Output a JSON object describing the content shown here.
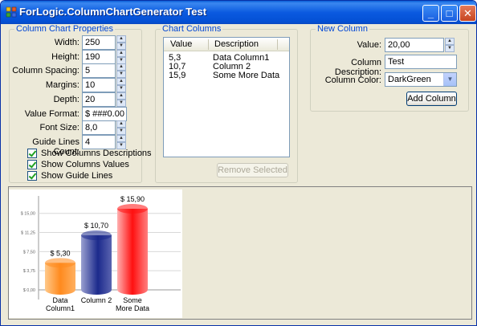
{
  "window": {
    "title": "ForLogic.ColumnChartGenerator Test"
  },
  "titlebar_buttons": {
    "minimize": "_",
    "maximize": "□",
    "close": "✕"
  },
  "props": {
    "group_label": "Column Chart Properties",
    "fields": [
      {
        "label": "Width:",
        "value": "250"
      },
      {
        "label": "Height:",
        "value": "190"
      },
      {
        "label": "Column Spacing:",
        "value": "5"
      },
      {
        "label": "Margins:",
        "value": "10"
      },
      {
        "label": "Depth:",
        "value": "20"
      },
      {
        "label": "Value Format:",
        "value": "$ ###0.00"
      },
      {
        "label": "Font Size:",
        "value": "8,0"
      },
      {
        "label": "Guide Lines Count:",
        "value": "4"
      }
    ],
    "checks": [
      {
        "label": "Show Columns Descriptions",
        "checked": true
      },
      {
        "label": "Show Columns Values",
        "checked": true
      },
      {
        "label": "Show Guide Lines",
        "checked": true
      }
    ]
  },
  "columns": {
    "group_label": "Chart Columns",
    "headers": [
      "Value",
      "Description"
    ],
    "rows": [
      {
        "value": "5,3",
        "desc": "Data Column1"
      },
      {
        "value": "10,7",
        "desc": "Column 2"
      },
      {
        "value": "15,9",
        "desc": "Some More Data"
      }
    ],
    "remove_label": "Remove Selected"
  },
  "new_column": {
    "group_label": "New Column",
    "value_label": "Value:",
    "value": "20,00",
    "desc_label": "Column Description:",
    "desc": "Test",
    "color_label": "Column Color:",
    "color": "DarkGreen",
    "add_label": "Add Column"
  },
  "chart_data": {
    "type": "bar",
    "categories": [
      "Data Column1",
      "Column 2",
      "Some More Data"
    ],
    "category_lines": [
      [
        "Data",
        "Column1"
      ],
      [
        "Column 2"
      ],
      [
        "Some",
        "More Data"
      ]
    ],
    "values": [
      5.3,
      10.7,
      15.9
    ],
    "value_labels": [
      "$ 5,30",
      "$ 10,70",
      "$ 15,90"
    ],
    "yticks": [
      0,
      3.75,
      7.5,
      11.25,
      15
    ],
    "ytick_labels": [
      "$ 0,00",
      "$ 3,75",
      "$ 7,50",
      "$ 11,25",
      "$ 15,00"
    ],
    "ylim": [
      0,
      15.9
    ],
    "colors": [
      "#ff8a1e",
      "#1c2a8c",
      "#ff1010"
    ],
    "grid": true
  }
}
